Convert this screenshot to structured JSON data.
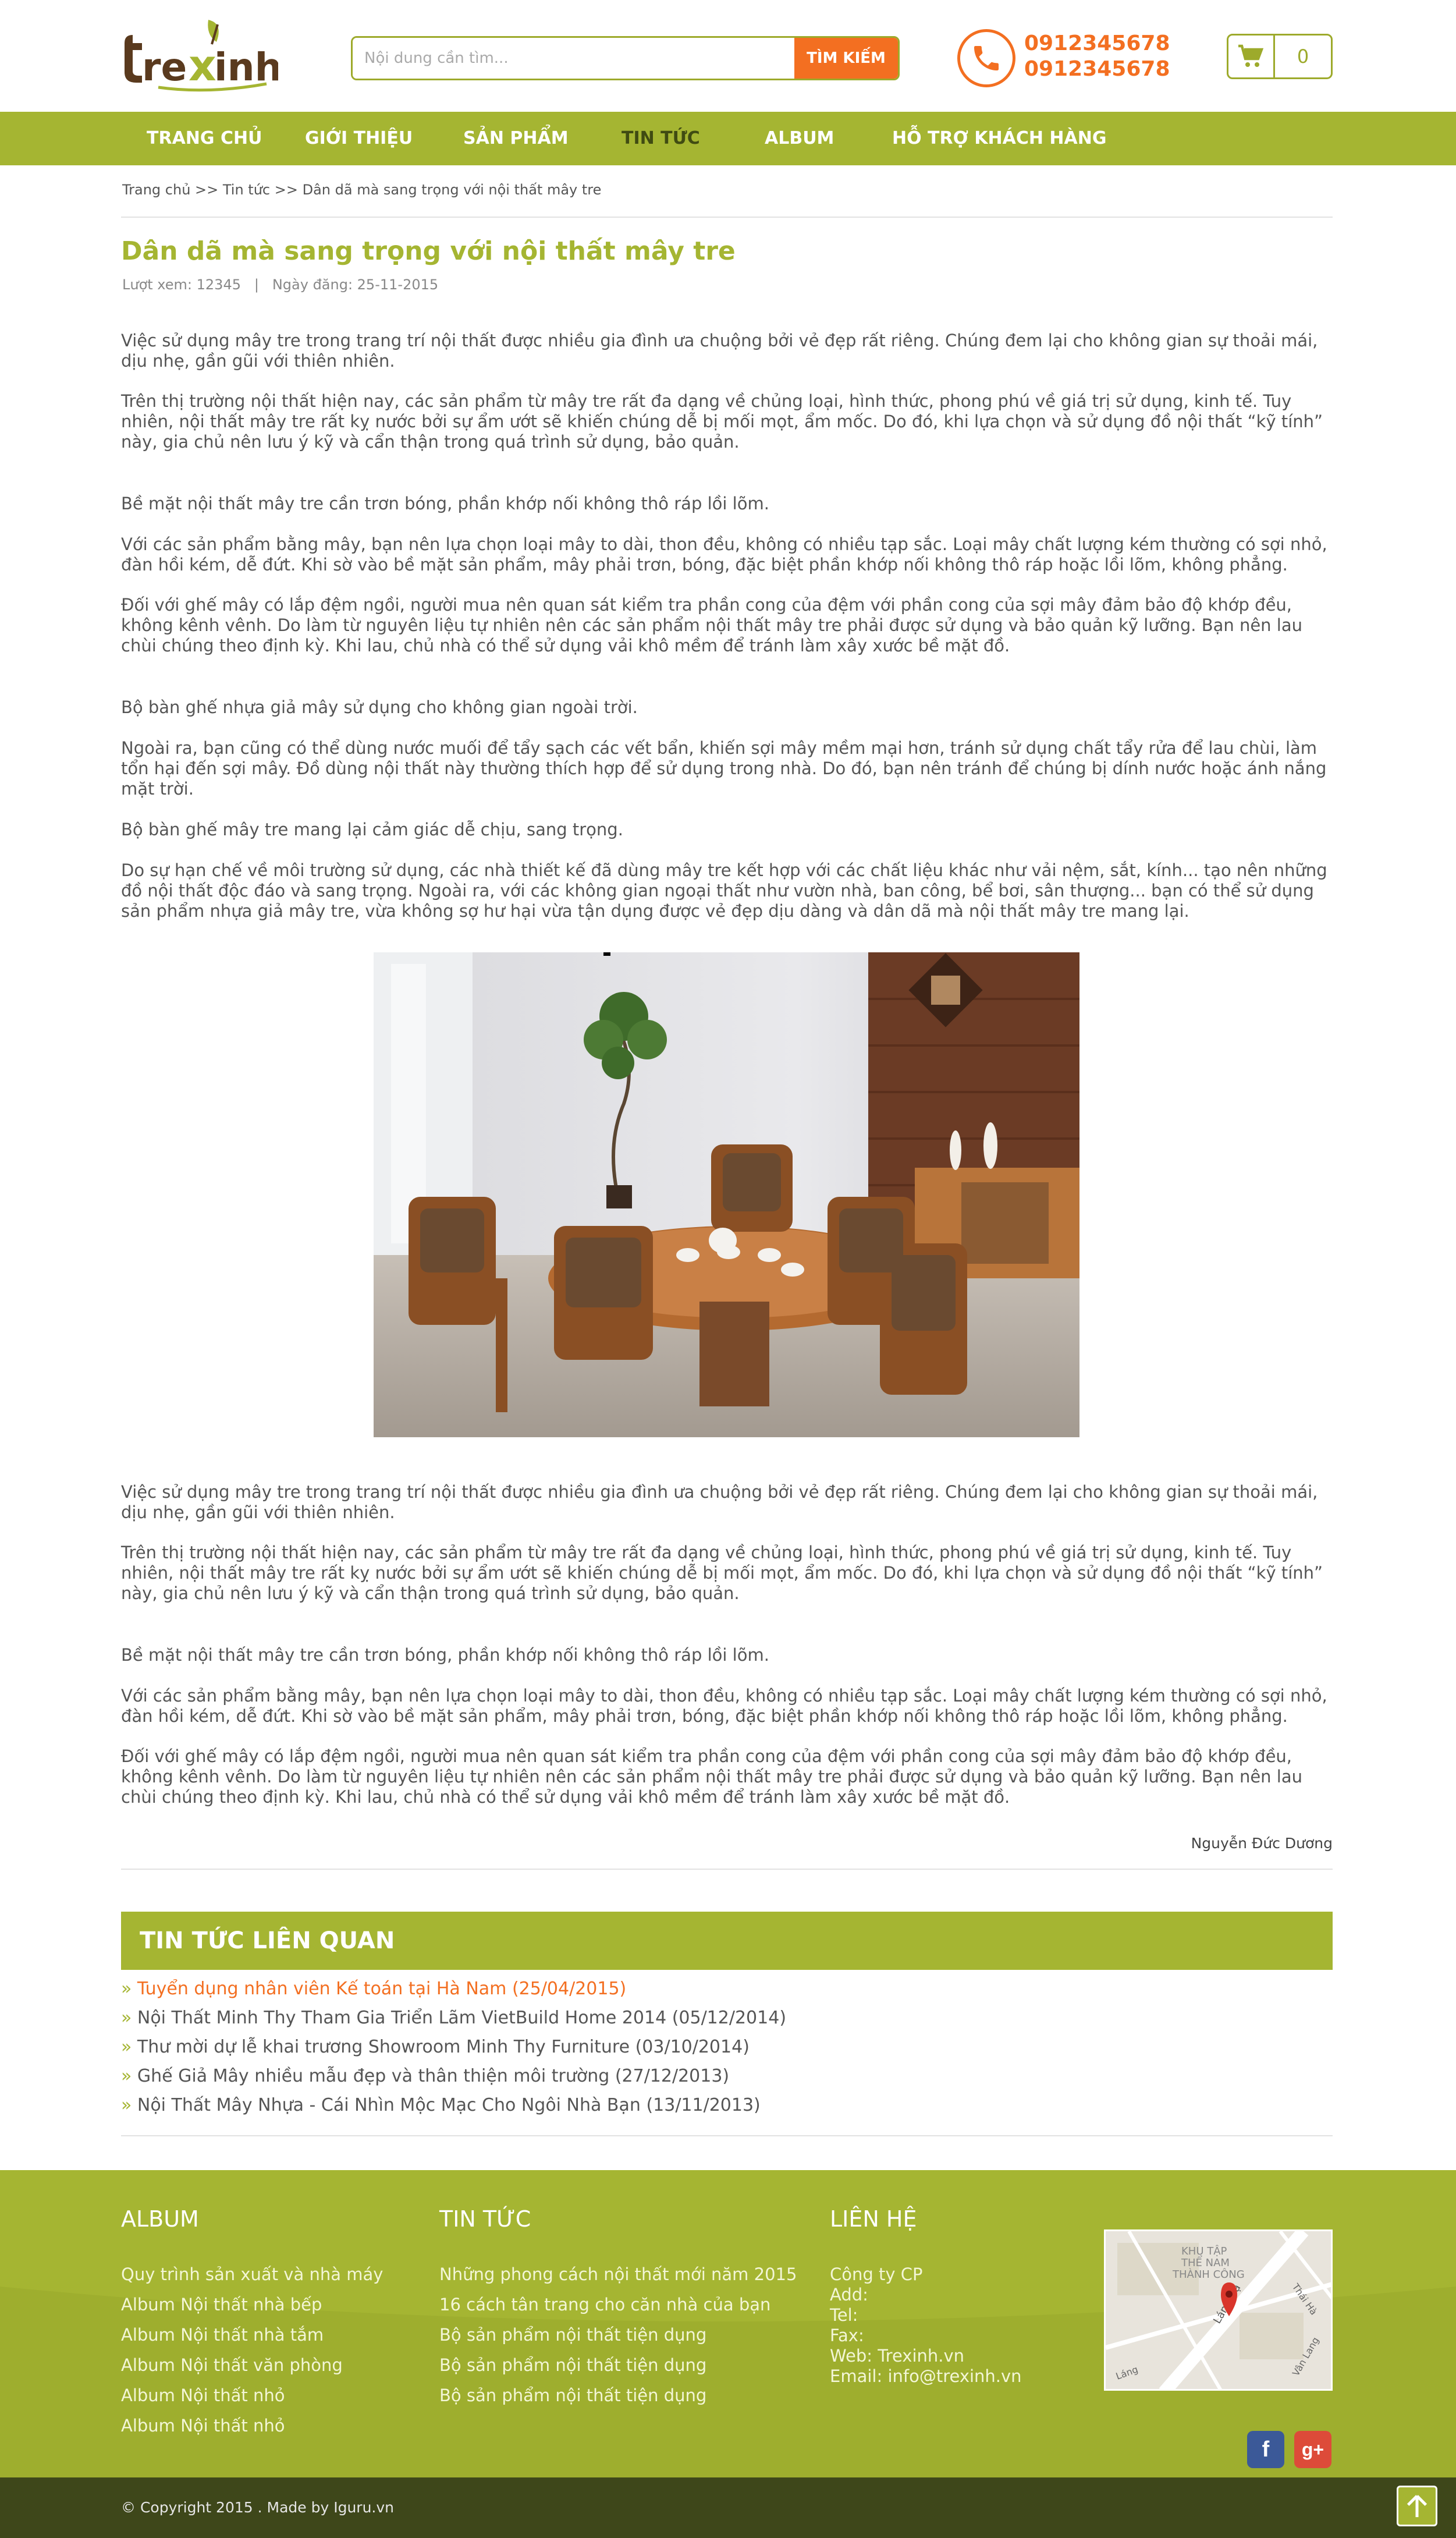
{
  "header": {
    "logo_text": "trexinh",
    "search_placeholder": "Nội dung cần tìm...",
    "search_button": "TÌM KIẾM",
    "phones": [
      "0912345678",
      "0912345678"
    ],
    "cart_count": "0"
  },
  "nav": [
    {
      "label": "TRANG CHỦ"
    },
    {
      "label": "GIỚI THIỆU"
    },
    {
      "label": "SẢN PHẨM"
    },
    {
      "label": "TIN TỨC"
    },
    {
      "label": "ALBUM"
    },
    {
      "label": "HỖ TRỢ KHÁCH HÀNG"
    }
  ],
  "breadcrumb": "Trang chủ >> Tin tức >> Dân dã mà sang trọng với nội thất mây tre",
  "article": {
    "title": "Dân dã mà sang trọng với nội thất mây tre",
    "meta": "Lượt xem: 12345   |   Ngày đăng: 25-11-2015",
    "paragraphs": [
      "Việc sử dụng mây tre trong trang trí nội thất được nhiều gia đình ưa chuộng bởi vẻ đẹp rất riêng. Chúng đem lại cho không gian sự thoải mái, dịu nhẹ, gần gũi với thiên nhiên.",
      "Trên thị trường nội thất hiện nay, các sản phẩm từ mây tre rất đa dạng về chủng loại, hình thức, phong phú về giá trị sử dụng, kinh tế. Tuy nhiên, nội thất mây tre rất kỵ nước bởi sự ẩm ướt sẽ khiến chúng dễ bị mối mọt, ẩm mốc. Do đó, khi lựa chọn và sử dụng đồ nội thất “kỹ tính” này, gia chủ nên lưu ý kỹ và cẩn thận trong quá trình sử dụng, bảo quản.",
      "Bề mặt nội thất mây tre cần trơn bóng, phần khớp nối không thô ráp lồi lõm.",
      "Với các sản phẩm bằng mây, bạn nên lựa chọn loại mây to dài, thon đều, không có nhiều tạp sắc. Loại mây chất lượng kém thường có sợi nhỏ, đàn hồi kém, dễ đứt. Khi sờ vào bề mặt sản phẩm, mây phải trơn, bóng, đặc biệt phần khớp nối không thô ráp hoặc lồi lõm, không phẳng.",
      "Đối với ghế mây có lắp đệm ngồi, người mua nên quan sát kiểm tra phần cong của đệm với phần cong của sợi mây đảm bảo độ khớp đều, không kênh vênh. Do làm từ nguyên liệu tự nhiên nên các sản phẩm nội thất mây tre phải được sử dụng và bảo quản kỹ lưỡng. Bạn nên lau chùi chúng theo định kỳ. Khi lau, chủ nhà có thể sử dụng vải khô mềm để tránh làm xây xước bề mặt đồ.",
      "Bộ bàn ghế nhựa giả mây sử dụng cho không gian ngoài trời.",
      "Ngoài ra, bạn cũng có thể dùng nước muối để tẩy sạch các vết bẩn, khiến sợi mây mềm mại hơn, tránh sử dụng chất tẩy rửa để lau chùi, làm tổn hại đến sợi mây. Đồ dùng nội thất này thường thích hợp để sử dụng trong nhà. Do đó, bạn nên tránh để chúng bị dính nước hoặc ánh nắng mặt trời.",
      "Bộ bàn ghế mây tre mang lại cảm giác dễ chịu, sang trọng.",
      "Do sự hạn chế về môi trường sử dụng, các nhà thiết kế đã dùng mây tre kết hợp với các chất liệu khác như vải nệm, sắt, kính... tạo nên những đồ nội thất độc đáo và sang trọng. Ngoài ra, với các không gian ngoại thất như vườn nhà, ban công, bể bơi, sân thượng... bạn có thể sử dụng sản phẩm nhựa giả mây tre, vừa không sợ hư hại vừa tận dụng được vẻ đẹp dịu dàng và dân dã mà nội thất mây tre mang lại."
    ],
    "paragraphs_after": [
      "Việc sử dụng mây tre trong trang trí nội thất được nhiều gia đình ưa chuộng bởi vẻ đẹp rất riêng. Chúng đem lại cho không gian sự thoải mái, dịu nhẹ, gần gũi với thiên nhiên.",
      "Trên thị trường nội thất hiện nay, các sản phẩm từ mây tre rất đa dạng về chủng loại, hình thức, phong phú về giá trị sử dụng, kinh tế. Tuy nhiên, nội thất mây tre rất kỵ nước bởi sự ẩm ướt sẽ khiến chúng dễ bị mối mọt, ẩm mốc. Do đó, khi lựa chọn và sử dụng đồ nội thất “kỹ tính” này, gia chủ nên lưu ý kỹ và cẩn thận trong quá trình sử dụng, bảo quản.",
      "Bề mặt nội thất mây tre cần trơn bóng, phần khớp nối không thô ráp lồi lõm.",
      "Với các sản phẩm bằng mây, bạn nên lựa chọn loại mây to dài, thon đều, không có nhiều tạp sắc. Loại mây chất lượng kém thường có sợi nhỏ, đàn hồi kém, dễ đứt. Khi sờ vào bề mặt sản phẩm, mây phải trơn, bóng, đặc biệt phần khớp nối không thô ráp hoặc lồi lõm, không phẳng.",
      "Đối với ghế mây có lắp đệm ngồi, người mua nên quan sát kiểm tra phần cong của đệm với phần cong của sợi mây đảm bảo độ khớp đều, không kênh vênh. Do làm từ nguyên liệu tự nhiên nên các sản phẩm nội thất mây tre phải được sử dụng và bảo quản kỹ lưỡng. Bạn nên lau chùi chúng theo định kỳ. Khi lau, chủ nhà có thể sử dụng vải khô mềm để tránh làm xây xước bề mặt đồ."
    ],
    "author": "Nguyễn Đức Dương"
  },
  "related": {
    "title": "TIN TỨC LIÊN QUAN",
    "items": [
      "Tuyển dụng nhân viên Kế toán tại Hà Nam (25/04/2015)",
      "Nội Thất Minh Thy Tham Gia Triển Lãm VietBuild Home 2014 (05/12/2014)",
      "Thư mời dự lễ khai trương Showroom Minh Thy Furniture (03/10/2014)",
      "Ghế Giả Mây nhiều mẫu đẹp và thân thiện môi trường (27/12/2013)",
      "Nội Thất Mây Nhựa - Cái Nhìn Mộc Mạc Cho Ngôi Nhà Bạn (13/11/2013)"
    ]
  },
  "footer": {
    "album": {
      "title": "ALBUM",
      "links": [
        "Quy trình sản xuất và nhà máy",
        "Album Nội thất nhà bếp",
        "Album Nội thất nhà tắm",
        "Album Nội thất văn phòng",
        "Album Nội thất nhỏ",
        "Album Nội thất nhỏ"
      ]
    },
    "news": {
      "title": "TIN TỨC",
      "links": [
        "Những phong cách nội thất mới năm 2015",
        "16 cách tân trang cho căn nhà của bạn",
        "Bộ sản phẩm nội thất tiện dụng",
        "Bộ sản phẩm nội thất tiện dụng",
        "Bộ sản phẩm nội thất tiện dụng"
      ]
    },
    "contact": {
      "title": "LIÊN HỆ",
      "lines": [
        "Công ty CP",
        "Add:",
        "Tel:",
        "Fax:",
        "Web: Trexinh.vn",
        "Email: info@trexinh.vn"
      ]
    },
    "map_labels": [
      "KHU TẬP",
      "THỂ NAM",
      "THÀNH CÔNG",
      "Láng Hạ",
      "Thái Hà",
      "Vân Lang",
      "Láng"
    ],
    "social": {
      "facebook": "f",
      "google": "g+"
    },
    "copyright": "© Copyright 2015  .  Made by Iguru.vn"
  },
  "colors": {
    "brand_green": "#a5b532",
    "accent_orange": "#f36f21",
    "footer_dark": "#3e471a"
  }
}
